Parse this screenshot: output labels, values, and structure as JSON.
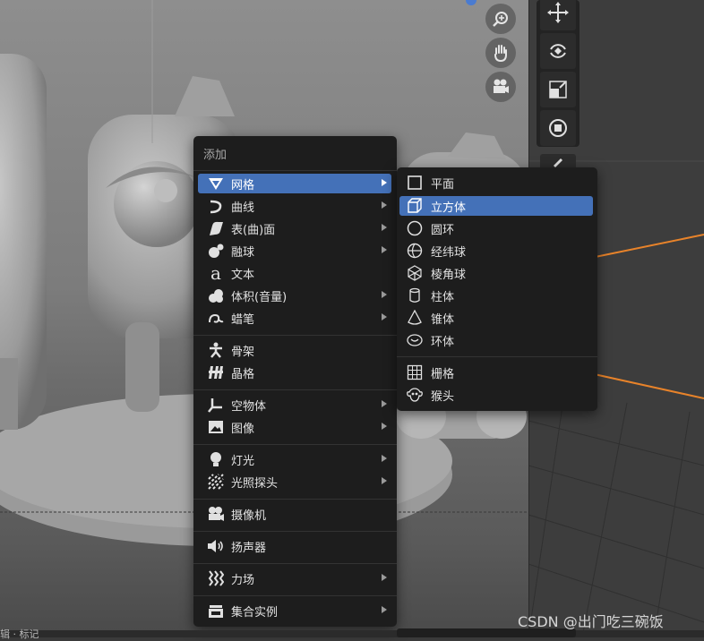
{
  "menu": {
    "title": "添加",
    "items": [
      {
        "label": "网格",
        "icon": "mesh-icon",
        "submenu": true,
        "active": true
      },
      {
        "label": "曲线",
        "icon": "curve-icon",
        "submenu": true
      },
      {
        "label": "表(曲)面",
        "icon": "surface-icon",
        "submenu": true
      },
      {
        "label": "融球",
        "icon": "metaball-icon",
        "submenu": true
      },
      {
        "label": "文本",
        "icon": "text-icon",
        "submenu": false
      },
      {
        "label": "体积(音量)",
        "icon": "volume-icon",
        "submenu": true
      },
      {
        "label": "蜡笔",
        "icon": "grease-pencil-icon",
        "submenu": true
      },
      {
        "label": "骨架",
        "icon": "armature-icon",
        "submenu": false
      },
      {
        "label": "晶格",
        "icon": "lattice-icon",
        "submenu": false
      },
      {
        "label": "空物体",
        "icon": "empty-icon",
        "submenu": true
      },
      {
        "label": "图像",
        "icon": "image-icon",
        "submenu": true
      },
      {
        "label": "灯光",
        "icon": "light-icon",
        "submenu": true
      },
      {
        "label": "光照探头",
        "icon": "light-probe-icon",
        "submenu": true
      },
      {
        "label": "摄像机",
        "icon": "camera-icon",
        "submenu": false
      },
      {
        "label": "扬声器",
        "icon": "speaker-icon",
        "submenu": false
      },
      {
        "label": "力场",
        "icon": "force-field-icon",
        "submenu": true
      },
      {
        "label": "集合实例",
        "icon": "collection-instance-icon",
        "submenu": true
      }
    ]
  },
  "submenu": {
    "items": [
      {
        "label": "平面",
        "icon": "plane-icon"
      },
      {
        "label": "立方体",
        "icon": "cube-icon",
        "active": true
      },
      {
        "label": "圆环",
        "icon": "circle-icon"
      },
      {
        "label": "经纬球",
        "icon": "uv-sphere-icon"
      },
      {
        "label": "棱角球",
        "icon": "ico-sphere-icon"
      },
      {
        "label": "柱体",
        "icon": "cylinder-icon"
      },
      {
        "label": "锥体",
        "icon": "cone-icon"
      },
      {
        "label": "环体",
        "icon": "torus-icon"
      },
      {
        "label": "栅格",
        "icon": "grid-icon"
      },
      {
        "label": "猴头",
        "icon": "monkey-icon"
      }
    ]
  },
  "viewport_nav": [
    "zoom-icon",
    "pan-hand-icon",
    "camera-view-icon"
  ],
  "tools": [
    "move-icon",
    "rotate-icon",
    "scale-icon",
    "transform-icon",
    "annotate-icon"
  ],
  "watermark": "CSDN @出门吃三碗饭",
  "status_bar": {
    "text": "辑 · 标记"
  },
  "colors": {
    "highlight": "#4471b8",
    "menu_bg": "#1d1d1d",
    "selection_outline": "#e8832a"
  }
}
